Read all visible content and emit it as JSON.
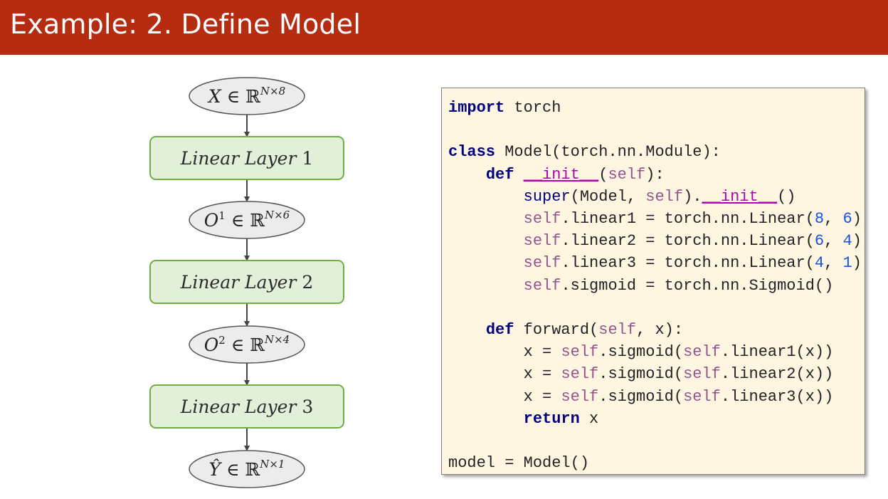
{
  "header": {
    "title": "Example: 2. Define Model"
  },
  "diagram": {
    "nodes": [
      {
        "kind": "data",
        "var": "X",
        "set": "ℝ",
        "sup": "N×8"
      },
      {
        "kind": "layer",
        "name": "Linear Layer",
        "num": "1"
      },
      {
        "kind": "data",
        "var": "O",
        "varsup": "1",
        "set": "ℝ",
        "sup": "N×6"
      },
      {
        "kind": "layer",
        "name": "Linear Layer",
        "num": "2"
      },
      {
        "kind": "data",
        "var": "O",
        "varsup": "2",
        "set": "ℝ",
        "sup": "N×4"
      },
      {
        "kind": "layer",
        "name": "Linear Layer",
        "num": "3"
      },
      {
        "kind": "data",
        "var": "Ŷ",
        "set": "ℝ",
        "sup": "N×1"
      }
    ]
  },
  "code": {
    "lines": [
      [
        [
          "kw",
          "import"
        ],
        [
          "t",
          " torch"
        ]
      ],
      [],
      [
        [
          "kw",
          "class"
        ],
        [
          "t",
          " Model(torch.nn.Module):"
        ]
      ],
      [
        [
          "t",
          "    "
        ],
        [
          "kw",
          "def"
        ],
        [
          "t",
          " "
        ],
        [
          "dunder",
          "__init__"
        ],
        [
          "t",
          "("
        ],
        [
          "slf",
          "self"
        ],
        [
          "t",
          "):"
        ]
      ],
      [
        [
          "t",
          "        "
        ],
        [
          "bi",
          "super"
        ],
        [
          "t",
          "(Model, "
        ],
        [
          "slf",
          "self"
        ],
        [
          "t",
          ")."
        ],
        [
          "dunder",
          "__init__"
        ],
        [
          "t",
          "()"
        ]
      ],
      [
        [
          "t",
          "        "
        ],
        [
          "slf",
          "self"
        ],
        [
          "t",
          ".linear1 = torch.nn.Linear("
        ],
        [
          "num",
          "8"
        ],
        [
          "t",
          ", "
        ],
        [
          "num",
          "6"
        ],
        [
          "t",
          ")"
        ]
      ],
      [
        [
          "t",
          "        "
        ],
        [
          "slf",
          "self"
        ],
        [
          "t",
          ".linear2 = torch.nn.Linear("
        ],
        [
          "num",
          "6"
        ],
        [
          "t",
          ", "
        ],
        [
          "num",
          "4"
        ],
        [
          "t",
          ")"
        ]
      ],
      [
        [
          "t",
          "        "
        ],
        [
          "slf",
          "self"
        ],
        [
          "t",
          ".linear3 = torch.nn.Linear("
        ],
        [
          "num",
          "4"
        ],
        [
          "t",
          ", "
        ],
        [
          "num",
          "1"
        ],
        [
          "t",
          ")"
        ]
      ],
      [
        [
          "t",
          "        "
        ],
        [
          "slf",
          "self"
        ],
        [
          "t",
          ".sigmoid = torch.nn.Sigmoid()"
        ]
      ],
      [],
      [
        [
          "t",
          "    "
        ],
        [
          "kw",
          "def"
        ],
        [
          "t",
          " forward("
        ],
        [
          "slf",
          "self"
        ],
        [
          "t",
          ", x):"
        ]
      ],
      [
        [
          "t",
          "        x = "
        ],
        [
          "slf",
          "self"
        ],
        [
          "t",
          ".sigmoid("
        ],
        [
          "slf",
          "self"
        ],
        [
          "t",
          ".linear1(x))"
        ]
      ],
      [
        [
          "t",
          "        x = "
        ],
        [
          "slf",
          "self"
        ],
        [
          "t",
          ".sigmoid("
        ],
        [
          "slf",
          "self"
        ],
        [
          "t",
          ".linear2(x))"
        ]
      ],
      [
        [
          "t",
          "        x = "
        ],
        [
          "slf",
          "self"
        ],
        [
          "t",
          ".sigmoid("
        ],
        [
          "slf",
          "self"
        ],
        [
          "t",
          ".linear3(x))"
        ]
      ],
      [
        [
          "t",
          "        "
        ],
        [
          "kw",
          "return"
        ],
        [
          "t",
          " x"
        ]
      ],
      [],
      [
        [
          "t",
          "model = Model()"
        ]
      ]
    ]
  },
  "colors": {
    "title_bar": "#b52c10",
    "layer_fill": "#e2efd9",
    "layer_border": "#70ad47",
    "data_fill": "#ececec",
    "data_border": "#555555",
    "code_bg": "#fff6e2"
  }
}
